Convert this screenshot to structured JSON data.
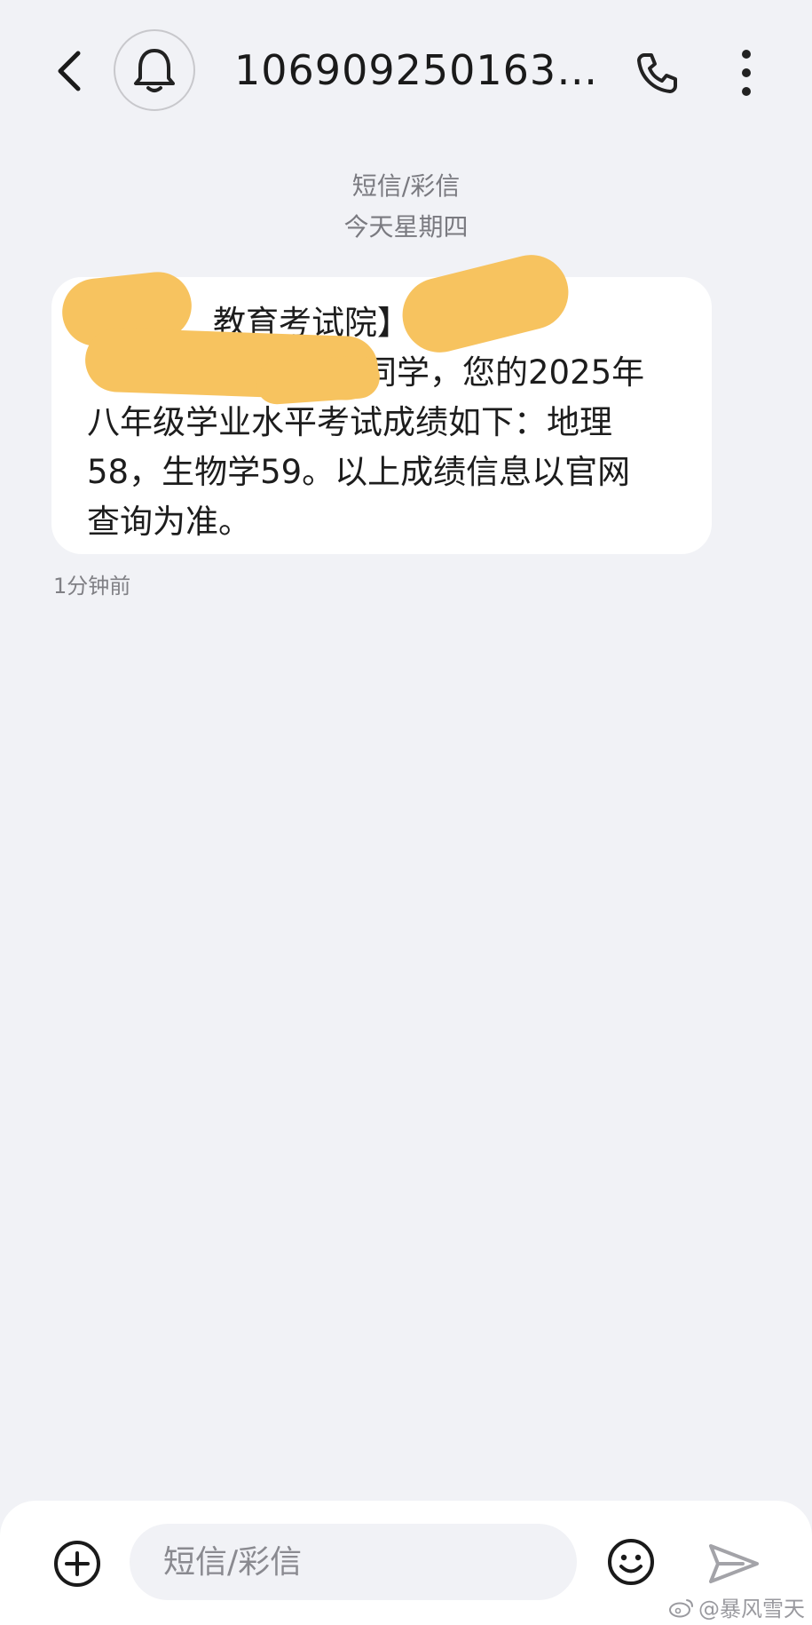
{
  "header": {
    "sender": "1069092501630…",
    "back_icon": "chevron-left-icon",
    "avatar_icon": "bell-icon",
    "call_icon": "phone-icon",
    "more_icon": "more-vertical-icon"
  },
  "thread": {
    "channel_label": "短信/彩信",
    "date_label": "今天星期四"
  },
  "message": {
    "lines": [
      "教育考试院】",
      "同学，您的2025年",
      "八年级学业水平考试成绩如下：地理",
      "58，生物学59。以上成绩信息以官网",
      "查询为准。"
    ],
    "time": "1分钟前"
  },
  "composer": {
    "placeholder": "短信/彩信",
    "attach_icon": "plus-circle-icon",
    "emoji_icon": "emoji-icon",
    "send_icon": "send-icon"
  },
  "watermark": {
    "text": "@暴风雪天",
    "icon": "weibo-icon"
  },
  "colors": {
    "background": "#f1f2f6",
    "bubble": "#ffffff",
    "redaction": "#f7c35f"
  }
}
